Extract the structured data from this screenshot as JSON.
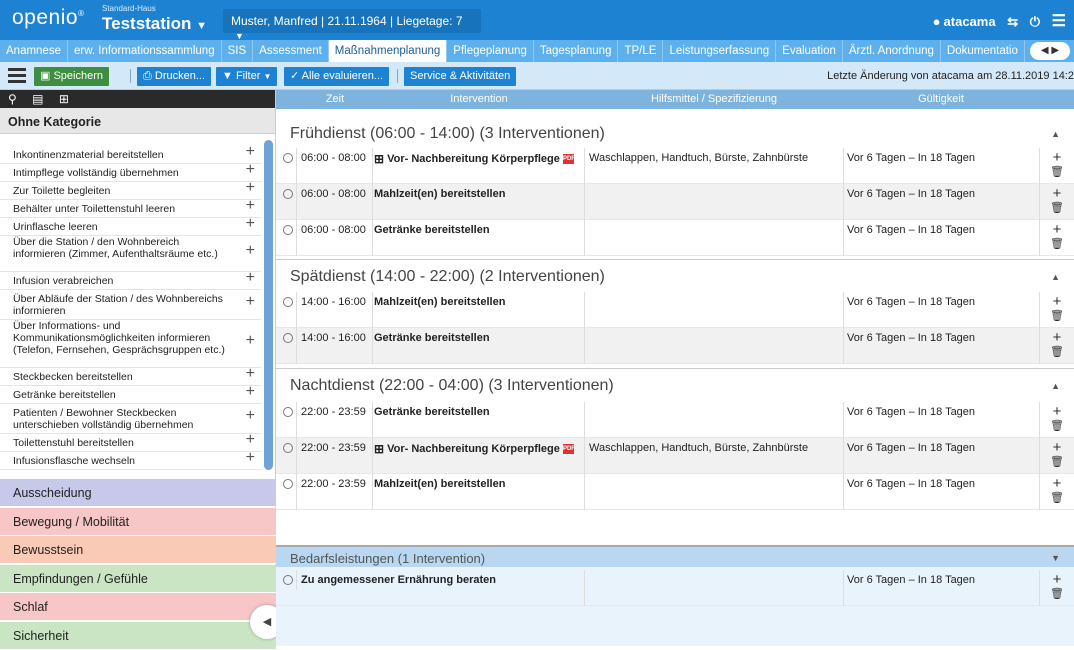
{
  "header": {
    "logo": "openio",
    "logo_mark": "®",
    "house": "Standard-Haus",
    "station": "Teststation",
    "patient": "Muster, Manfred | 21.11.1964 | Liegetage: 7",
    "user": "atacama"
  },
  "tabs": [
    "Anamnese",
    "erw. Informationssammlung",
    "SIS",
    "Assessment",
    "Maßnahmenplanung",
    "Pflegeplanung",
    "Tagesplanung",
    "TP/LE",
    "Leistungserfassung",
    "Evaluation",
    "Ärztl. Anordnung",
    "Dokumentatio"
  ],
  "active_tab": "Maßnahmenplanung",
  "toolbar": {
    "save": "Speichern",
    "print": "Drucken...",
    "filter": "Filter",
    "evaluate": "Alle evaluieren...",
    "service": "Service & Aktivitäten",
    "last_change": "Letzte Änderung von atacama am 28.11.2019 14:2"
  },
  "left_panel": {
    "category_title": "Ohne Kategorie",
    "items": [
      "Inkontinenzmaterial bereitstellen",
      "Intimpflege vollständig übernehmen",
      "Zur Toilette begleiten",
      "Behälter unter Toilettenstuhl leeren",
      "Urinflasche leeren",
      "Über die Station / den Wohnbereich informieren (Zimmer, Aufenthaltsräume etc.)",
      "Infusion verabreichen",
      "Über Abläufe der Station / des Wohnbereichs informieren",
      "Über Informations- und Kommunikationsmöglichkeiten informieren (Telefon, Fernsehen, Gesprächsgruppen etc.)",
      "Steckbecken bereitstellen",
      "Getränke bereitstellen",
      "Patienten / Bewohner Steckbecken unterschieben vollständig übernehmen",
      "Toilettenstuhl bereitstellen",
      "Infusionsflasche wechseln"
    ],
    "categories": [
      {
        "label": "Ausscheidung",
        "color": "#c7c9ea"
      },
      {
        "label": "Bewegung / Mobilität",
        "color": "#f7c6c6"
      },
      {
        "label": "Bewusstsein",
        "color": "#f9cbb6"
      },
      {
        "label": "Empfindungen / Gefühle",
        "color": "#c9e5c3"
      },
      {
        "label": "Schlaf",
        "color": "#f7c6c6"
      },
      {
        "label": "Sicherheit",
        "color": "#c9e5c3"
      }
    ]
  },
  "columns": [
    "Zeit",
    "Intervention",
    "Hilfsmittel / Spezifizierung",
    "Gültigkeit"
  ],
  "sections": [
    {
      "title": "Frühdienst (06:00 - 14:00) (3 Interventionen)",
      "rows": [
        {
          "time": "06:00 - 08:00",
          "intervention": "Vor- Nachbereitung Körperpflege",
          "grid": true,
          "pdf": true,
          "aids": "Waschlappen, Handtuch, Bürste, Zahnbürste",
          "validity": "Vor 6 Tagen – In 18 Tagen"
        },
        {
          "time": "06:00 - 08:00",
          "intervention": "Mahlzeit(en) bereitstellen",
          "aids": "",
          "validity": "Vor 6 Tagen – In 18 Tagen"
        },
        {
          "time": "06:00 - 08:00",
          "intervention": "Getränke bereitstellen",
          "aids": "",
          "validity": "Vor 6 Tagen – In 18 Tagen"
        }
      ]
    },
    {
      "title": "Spätdienst (14:00 - 22:00) (2 Interventionen)",
      "rows": [
        {
          "time": "14:00 - 16:00",
          "intervention": "Mahlzeit(en) bereitstellen",
          "aids": "",
          "validity": "Vor 6 Tagen – In 18 Tagen"
        },
        {
          "time": "14:00 - 16:00",
          "intervention": "Getränke bereitstellen",
          "aids": "",
          "validity": "Vor 6 Tagen – In 18 Tagen"
        }
      ]
    },
    {
      "title": "Nachtdienst (22:00 - 04:00) (3 Interventionen)",
      "rows": [
        {
          "time": "22:00 - 23:59",
          "intervention": "Getränke bereitstellen",
          "aids": "",
          "validity": "Vor 6 Tagen – In 18 Tagen"
        },
        {
          "time": "22:00 - 23:59",
          "intervention": "Vor- Nachbereitung Körperpflege",
          "grid": true,
          "pdf": true,
          "aids": "Waschlappen, Handtuch, Bürste, Zahnbürste",
          "validity": "Vor 6 Tagen – In 18 Tagen"
        },
        {
          "time": "22:00 - 23:59",
          "intervention": "Mahlzeit(en) bereitstellen",
          "aids": "",
          "validity": "Vor 6 Tagen – In 18 Tagen"
        }
      ]
    }
  ],
  "bedarf": {
    "title": "Bedarfsleistungen (1 Intervention)",
    "rows": [
      {
        "intervention": "Zu angemessener Ernährung beraten",
        "validity": "Vor 6 Tagen – In 18 Tagen"
      }
    ]
  }
}
